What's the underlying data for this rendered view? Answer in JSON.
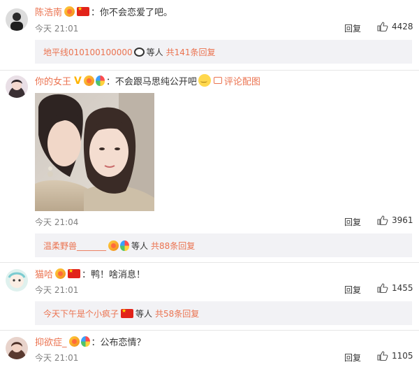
{
  "comments": [
    {
      "user": "陈浩南",
      "text": "你不会恋爱了吧。",
      "time": "今天 21:01",
      "reply": "回复",
      "likes": "4428",
      "sub": {
        "name": "地平线010100100000",
        "etc": "等人",
        "count": "共141条回复"
      }
    },
    {
      "user": "你的女王",
      "text": "不会跟马思纯公开吧",
      "pic_link": "评论配图",
      "time": "今天 21:04",
      "reply": "回复",
      "likes": "3961",
      "sub": {
        "name": "温柔野兽_______",
        "etc": "等人",
        "count": "共88条回复"
      }
    },
    {
      "user": "猫哈",
      "text": "鸭！啥消息！",
      "time": "今天 21:01",
      "reply": "回复",
      "likes": "1455",
      "sub": {
        "name": "今天下午是个小疯子",
        "etc": "等人",
        "count": "共58条回复"
      }
    },
    {
      "user": "抑欲症_",
      "text": "公布恋情？",
      "time": "今天 21:01",
      "reply": "回复",
      "likes": "1105"
    }
  ],
  "colors": {
    "username": "#eb7350",
    "subbox_bg": "#f2f2f5",
    "time": "#808080"
  },
  "icons": {
    "like": "thumb-up-icon",
    "pic": "image-icon"
  }
}
